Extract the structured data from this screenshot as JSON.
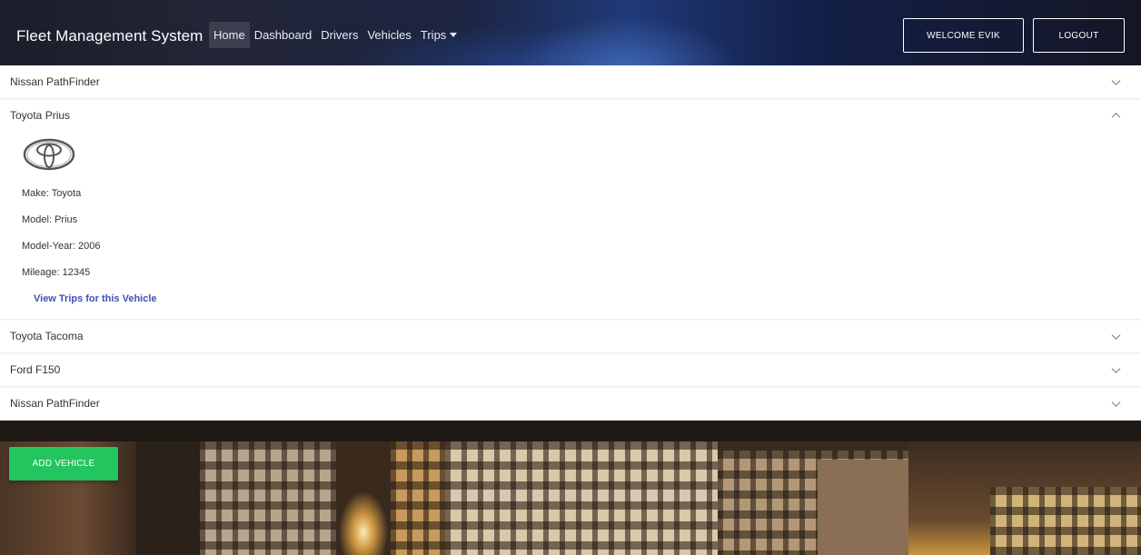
{
  "navbar": {
    "brand": "Fleet Management System",
    "links": [
      "Home",
      "Dashboard",
      "Drivers",
      "Vehicles",
      "Trips"
    ],
    "welcome_label": "WELCOME EVIK",
    "logout_label": "LOGOUT"
  },
  "vehicles": [
    {
      "title": "Nissan PathFinder",
      "expanded": false
    },
    {
      "title": "Toyota Prius",
      "expanded": true,
      "logo_icon": "toyota-logo-icon",
      "make": "Make: Toyota",
      "model": "Model: Prius",
      "model_year": "Model-Year: 2006",
      "mileage": "Mileage: 12345",
      "trips_link": "View Trips for this Vehicle"
    },
    {
      "title": "Toyota Tacoma",
      "expanded": false
    },
    {
      "title": "Ford F150",
      "expanded": false
    },
    {
      "title": "Nissan PathFinder",
      "expanded": false
    }
  ],
  "add_vehicle_label": "ADD VEHICLE",
  "colors": {
    "add_button": "#22c55e",
    "link": "#3f51b5"
  }
}
